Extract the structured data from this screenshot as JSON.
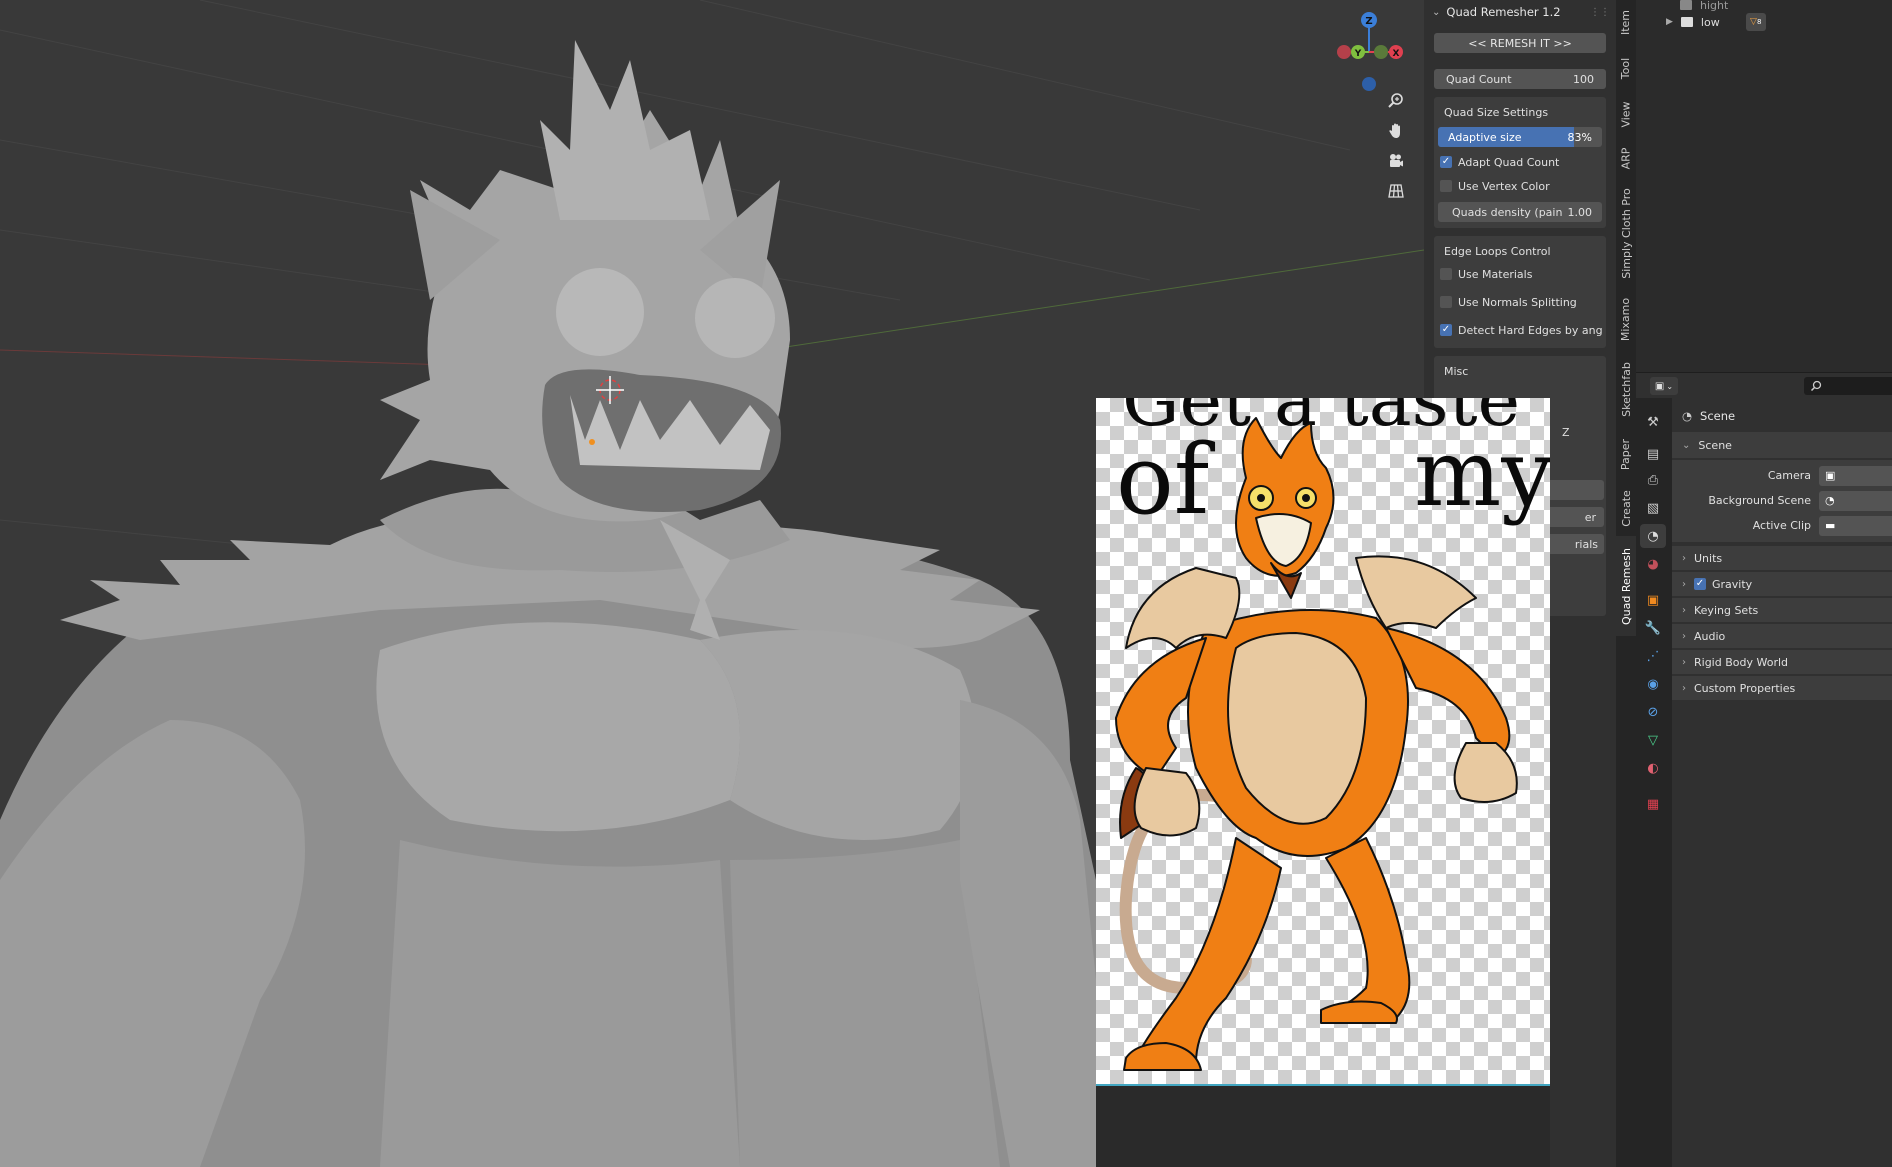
{
  "quad_remesher": {
    "title": "Quad Remesher 1.2",
    "remesh_button": "<<  REMESH IT >>",
    "quad_count_label": "Quad Count",
    "quad_count_value": "100",
    "size_settings_title": "Quad Size Settings",
    "adaptive_label": "Adaptive size",
    "adaptive_value": "83%",
    "adaptive_fraction": 0.83,
    "adapt_quad_count": "Adapt Quad Count",
    "use_vertex_color": "Use Vertex Color",
    "quads_density_label": "Quads density (pain",
    "quads_density_value": "1.00",
    "edge_loops_title": "Edge Loops Control",
    "use_materials": "Use Materials",
    "use_normals_splitting": "Use Normals Splitting",
    "detect_hard_edges": "Detect Hard Edges by ang...",
    "misc_title": "Misc",
    "hidden_fragments": [
      "Z",
      "er",
      "rials"
    ]
  },
  "sidebar_tabs": [
    "Item",
    "Tool",
    "View",
    "ARP",
    "Simply Cloth Pro",
    "Mixamo",
    "Sketchfab",
    "Paper",
    "Create",
    "Quad Remesh"
  ],
  "outliner": {
    "items": [
      {
        "label": "hight"
      },
      {
        "label": "low",
        "badge": "8"
      }
    ]
  },
  "properties": {
    "context_title": "Scene",
    "panel_title": "Scene",
    "camera_label": "Camera",
    "background_scene_label": "Background Scene",
    "active_clip_label": "Active Clip",
    "panels": [
      "Units",
      "Gravity",
      "Keying Sets",
      "Audio",
      "Rigid Body World",
      "Custom Properties"
    ]
  },
  "meme": {
    "line1": "Get a taste",
    "word_of": "of",
    "word_my": "my"
  },
  "gizmo": {
    "z": "Z",
    "y": "Y",
    "x": "X"
  },
  "colors": {
    "accent": "#4772b3",
    "x_axis": "#e04050",
    "y_axis": "#7fbf3f",
    "z_axis": "#3b7fd9",
    "character_orange": "#f07f14",
    "character_cream": "#e8c9a0"
  }
}
